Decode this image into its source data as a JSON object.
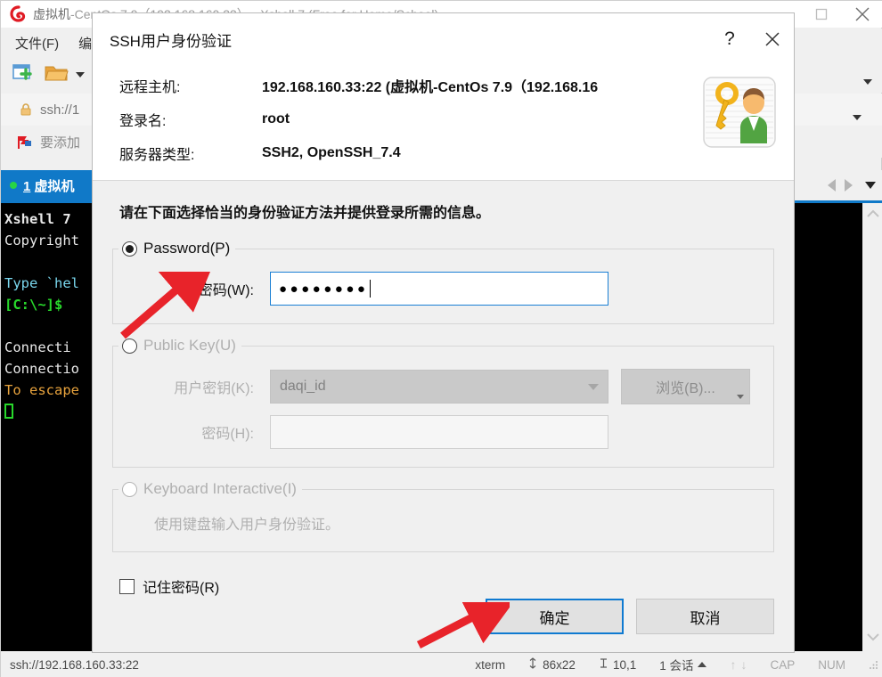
{
  "window": {
    "title_prefix": "虚拟机",
    "title": "虚拟机-CentOs 7.9（192.168.160.33） - Xshell 7 (Free for Home/School)",
    "maximize_label": "❐",
    "close_label": "✕"
  },
  "menu": {
    "items": [
      {
        "label": "文件(F)"
      },
      {
        "label": "编"
      }
    ]
  },
  "toolbar": {
    "new_session_icon": "new-session-icon",
    "open_folder_icon": "open-folder-icon",
    "dropdown_icon": "chevron-down-icon"
  },
  "address": {
    "lock_icon": "lock-icon",
    "text": "ssh://1"
  },
  "bookmark": {
    "flag_icon": "flag-icon",
    "text": "要添加"
  },
  "tabs": {
    "active": {
      "index": "1",
      "label": "虚拟机"
    },
    "nav_prev": "prev-arrow-icon",
    "nav_next": "next-arrow-icon",
    "nav_menu": "chevron-down-icon"
  },
  "terminal": {
    "lines": [
      {
        "text": "Xshell 7",
        "style": "bold"
      },
      {
        "text": "Copyright",
        "style": "plain"
      },
      {
        "text": "",
        "style": "plain"
      },
      {
        "text": "Type `hel",
        "style": "cyan"
      },
      {
        "text": "[C:\\~]$",
        "style": "green"
      },
      {
        "text": "",
        "style": "plain"
      },
      {
        "text": "Connecti",
        "style": "plain"
      },
      {
        "text": "Connectio",
        "style": "plain"
      },
      {
        "text": "To escape",
        "style": "orange"
      }
    ],
    "cursor": "block-cursor"
  },
  "status_bar": {
    "connection": "ssh://192.168.160.33:22",
    "terminal_type": "xterm",
    "size_icon": "resize-icon",
    "size": "86x22",
    "cursor_icon": "cursor-pos-icon",
    "cursor_pos": "10,1",
    "sessions": "1 会话",
    "sessions_caret": "caret-up-icon",
    "upload_icon": "arrow-up-icon",
    "download_icon": "arrow-down-icon",
    "caps": "CAP",
    "num": "NUM"
  },
  "dialog": {
    "title": "SSH用户身份验证",
    "help_label": "?",
    "close_label": "✕",
    "icon_name": "key-user-icon",
    "info": [
      {
        "label": "远程主机:",
        "value": "192.168.160.33:22 (虚拟机-CentOs 7.9（192.168.16"
      },
      {
        "label": "登录名:",
        "value": "root"
      },
      {
        "label": "服务器类型:",
        "value": "SSH2, OpenSSH_7.4"
      }
    ],
    "prompt": "请在下面选择恰当的身份验证方法并提供登录所需的信息。",
    "password_group": {
      "legend": "Password(P)",
      "selected": true,
      "field_label": "密码(W):",
      "value_dots": "●●●●●●●●",
      "value_length": 8
    },
    "publickey_group": {
      "legend": "Public Key(U)",
      "selected": false,
      "key_label": "用户密钥(K):",
      "key_value": "daqi_id",
      "browse_label": "浏览(B)...",
      "passphrase_label": "密码(H):",
      "passphrase_value": ""
    },
    "keyboard_group": {
      "legend": "Keyboard Interactive(I)",
      "selected": false,
      "description": "使用键盘输入用户身份验证。"
    },
    "remember": {
      "label": "记住密码(R)",
      "checked": false
    },
    "buttons": {
      "ok": "确定",
      "cancel": "取消"
    }
  },
  "annotations": {
    "arrow_color": "#e8232a",
    "arrow_password_target": "密码(W) 输入框",
    "arrow_ok_target": "确定 按钮"
  },
  "colors": {
    "accent_blue": "#1079c8",
    "focus_blue": "#0f7ad1",
    "tab_active_bg": "#1079c8",
    "terminal_bg": "#000000",
    "dialog_bg": "#f0f0f0",
    "annotation_red": "#e8232a"
  }
}
